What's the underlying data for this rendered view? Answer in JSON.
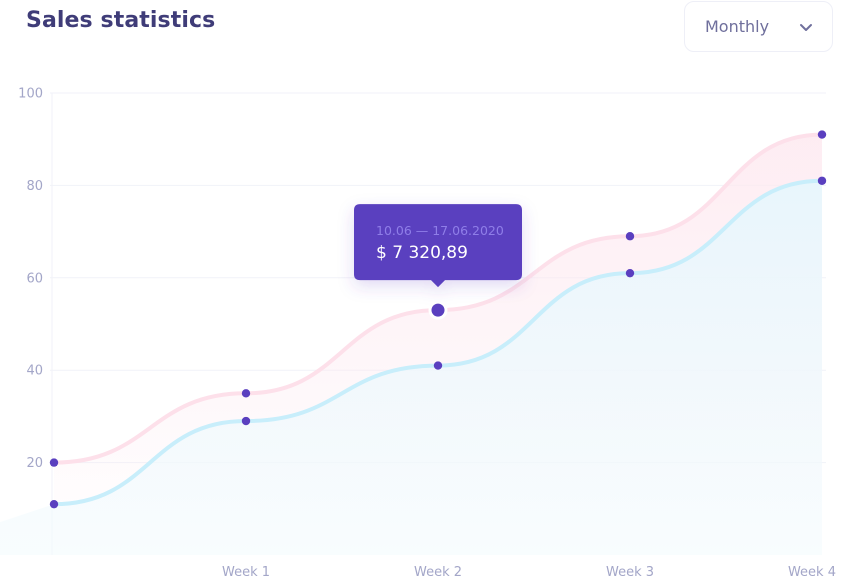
{
  "header": {
    "title": "Sales statistics",
    "period_select": {
      "value": "Monthly",
      "icon": "chevron-down-icon"
    }
  },
  "tooltip": {
    "date_range": "10.06 — 17.06.2020",
    "value": "$ 7 320,89",
    "series_index": 0,
    "point_index": 2
  },
  "colors": {
    "title": "#3f3c78",
    "point": "#5a3fbf",
    "tooltip_bg": "#5a3fbf",
    "series_1": "#fde0ea",
    "series_2": "#c8eefb",
    "axis_text": "#a3a6c8"
  },
  "chart_data": {
    "type": "line",
    "title": "Sales statistics",
    "x": [
      0,
      1,
      2,
      3,
      4
    ],
    "x_tick_labels": [
      "Week 1",
      "Week 2",
      "Week 3",
      "Week 4"
    ],
    "ylim": [
      0,
      100
    ],
    "y_ticks": [
      20,
      40,
      60,
      80,
      100
    ],
    "grid": true,
    "series": [
      {
        "values": [
          20,
          35,
          53,
          69,
          91
        ]
      },
      {
        "values": [
          11,
          29,
          41,
          61,
          81
        ]
      }
    ]
  }
}
